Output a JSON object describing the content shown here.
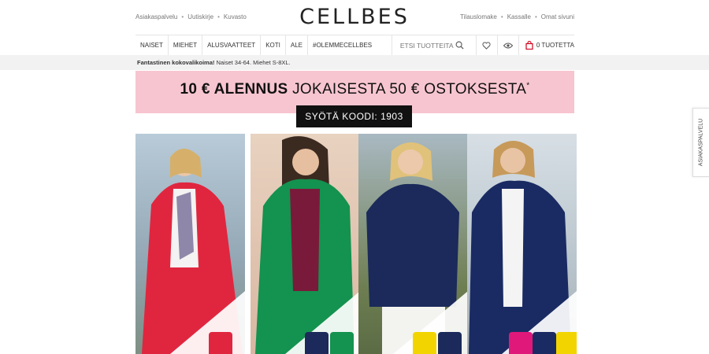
{
  "top_links": [
    "Asiakaspalvelu",
    "Uutiskirje",
    "Kuvasto"
  ],
  "top_right_links": [
    "Tilauslomake",
    "Kassalle",
    "Omat sivuni"
  ],
  "logo": "CELLBES",
  "nav": {
    "items": [
      "NAISET",
      "MIEHET",
      "ALUSVAATTEET",
      "KOTI",
      "ALE",
      "#OLEMMECELLBES"
    ],
    "search_placeholder": "ETSI TUOTTEITA",
    "cart_label": "0 TUOTETTA"
  },
  "info_strip": {
    "bold": "Fantastinen kokovalikoima!",
    "rest": " Naiset 34-64. Miehet S-8XL."
  },
  "banner": {
    "bold": "10 € ALENNUS",
    "rest": " JOKAISESTA 50 € OSTOKSESTA",
    "asterisk": "*",
    "code": "SYÖTÄ KOODI: 1903"
  },
  "side_tab": "ASIAKASPALVELU",
  "products": [
    {
      "jacket_color": "#e0263f",
      "bg": "#9fb6c6"
    },
    {
      "jacket_color": "#14924f",
      "bg": "#e6c8b4"
    },
    {
      "jacket_color": "#1b2a5a",
      "bg": "#7b8a5a"
    },
    {
      "jacket_color": "#1a2b63",
      "bg": "#c9d3da"
    }
  ]
}
